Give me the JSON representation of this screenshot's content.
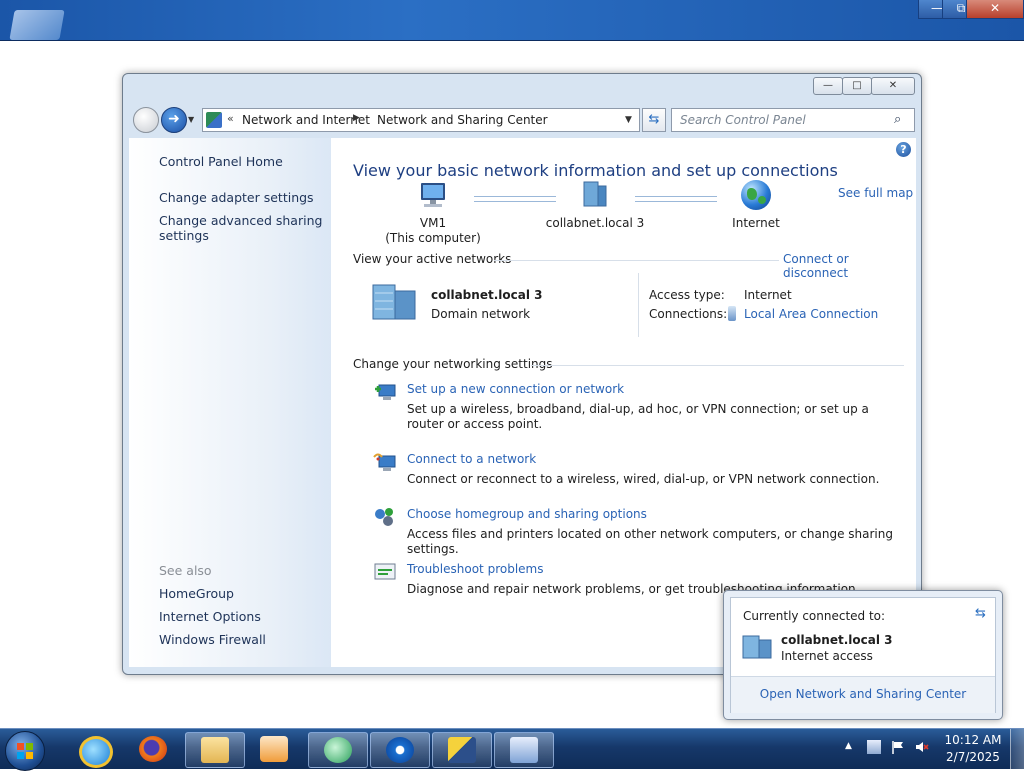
{
  "host": {
    "min": "—",
    "max": "⧉",
    "close": "✕"
  },
  "window": {
    "caption": {
      "min": "—",
      "max": "□",
      "close": "✕"
    },
    "address": {
      "chevron": "«",
      "crumb1": "Network and Internet",
      "separator": "▶",
      "crumb2": "Network and Sharing Center"
    },
    "search_placeholder": "Search Control Panel",
    "sidebar": {
      "home": "Control Panel Home",
      "adapter": "Change adapter settings",
      "advanced_line1": "Change advanced sharing",
      "advanced_line2": "settings",
      "see_also": "See also",
      "homegroup": "HomeGroup",
      "internet_options": "Internet Options",
      "firewall": "Windows Firewall"
    },
    "main": {
      "title": "View your basic network information and set up connections",
      "see_full_map": "See full map",
      "map": {
        "computer_name": "VM1",
        "computer_sub": "(This computer)",
        "network_name": "collabnet.local  3",
        "internet": "Internet"
      },
      "active_networks_title": "View your active networks",
      "connect_link": "Connect or disconnect",
      "active": {
        "name": "collabnet.local  3",
        "type": "Domain network",
        "access_label": "Access type:",
        "access_value": "Internet",
        "connections_label": "Connections:",
        "connections_value": "Local Area Connection"
      },
      "change_title": "Change your networking settings",
      "tasks": [
        {
          "link": "Set up a new connection or network",
          "desc": "Set up a wireless, broadband, dial-up, ad hoc, or VPN connection; or set up a router or access point."
        },
        {
          "link": "Connect to a network",
          "desc": "Connect or reconnect to a wireless, wired, dial-up, or VPN network connection."
        },
        {
          "link": "Choose homegroup and sharing options",
          "desc": "Access files and printers located on other network computers, or change sharing settings."
        },
        {
          "link": "Troubleshoot problems",
          "desc": "Diagnose and repair network problems, or get troubleshooting information."
        }
      ]
    }
  },
  "popup": {
    "title": "Currently connected to:",
    "network": "collabnet.local  3",
    "status": "Internet access",
    "open_link": "Open Network and Sharing Center"
  },
  "taskbar": {
    "apps": [
      "internet-explorer",
      "firefox",
      "file-explorer",
      "media-player",
      "app-1",
      "app-2",
      "app-3",
      "app-4"
    ],
    "clock_time": "10:12 AM",
    "clock_date": "2/7/2025"
  },
  "colors": {
    "link": "#2a63b5",
    "title": "#1e3f82",
    "taskbar": "#16386a"
  }
}
